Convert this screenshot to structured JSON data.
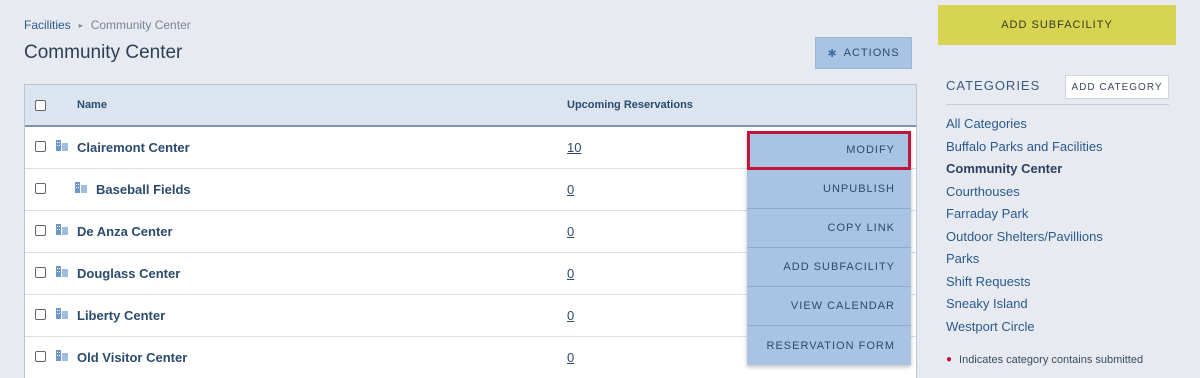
{
  "breadcrumb": {
    "parent": "Facilities",
    "separator": "▸",
    "current": "Community Center"
  },
  "page_title": "Community Center",
  "actions_label": "ACTIONS",
  "table": {
    "headers": {
      "name": "Name",
      "reservations": "Upcoming Reservations"
    },
    "rows": [
      {
        "name": "Clairemont Center",
        "count": "10"
      },
      {
        "name": "Baseball Fields",
        "count": "0"
      },
      {
        "name": "De Anza Center",
        "count": "0"
      },
      {
        "name": "Douglass Center",
        "count": "0"
      },
      {
        "name": "Liberty Center",
        "count": "0"
      },
      {
        "name": "Old Visitor Center",
        "count": "0"
      }
    ]
  },
  "dropdown": {
    "items": [
      "MODIFY",
      "UNPUBLISH",
      "COPY LINK",
      "ADD SUBFACILITY",
      "VIEW CALENDAR",
      "RESERVATION FORM"
    ]
  },
  "sidebar": {
    "add_subfacility": "ADD SUBFACILITY",
    "categories_title": "CATEGORIES",
    "add_category": "ADD CATEGORY",
    "categories": [
      "All Categories",
      "Buffalo Parks and Facilities",
      "Community Center",
      "Courthouses",
      "Farraday Park",
      "Outdoor Shelters/Pavillions",
      "Parks",
      "Shift Requests",
      "Sneaky Island",
      "Westport Circle"
    ],
    "note": "Indicates category contains submitted"
  },
  "colors": {
    "accent_button": "#d6d450",
    "menu_bg": "#a9c4e2",
    "highlight": "#c0143c"
  },
  "icons": {
    "row_icon": "building-icon",
    "actions_icon": "gear-icon"
  }
}
